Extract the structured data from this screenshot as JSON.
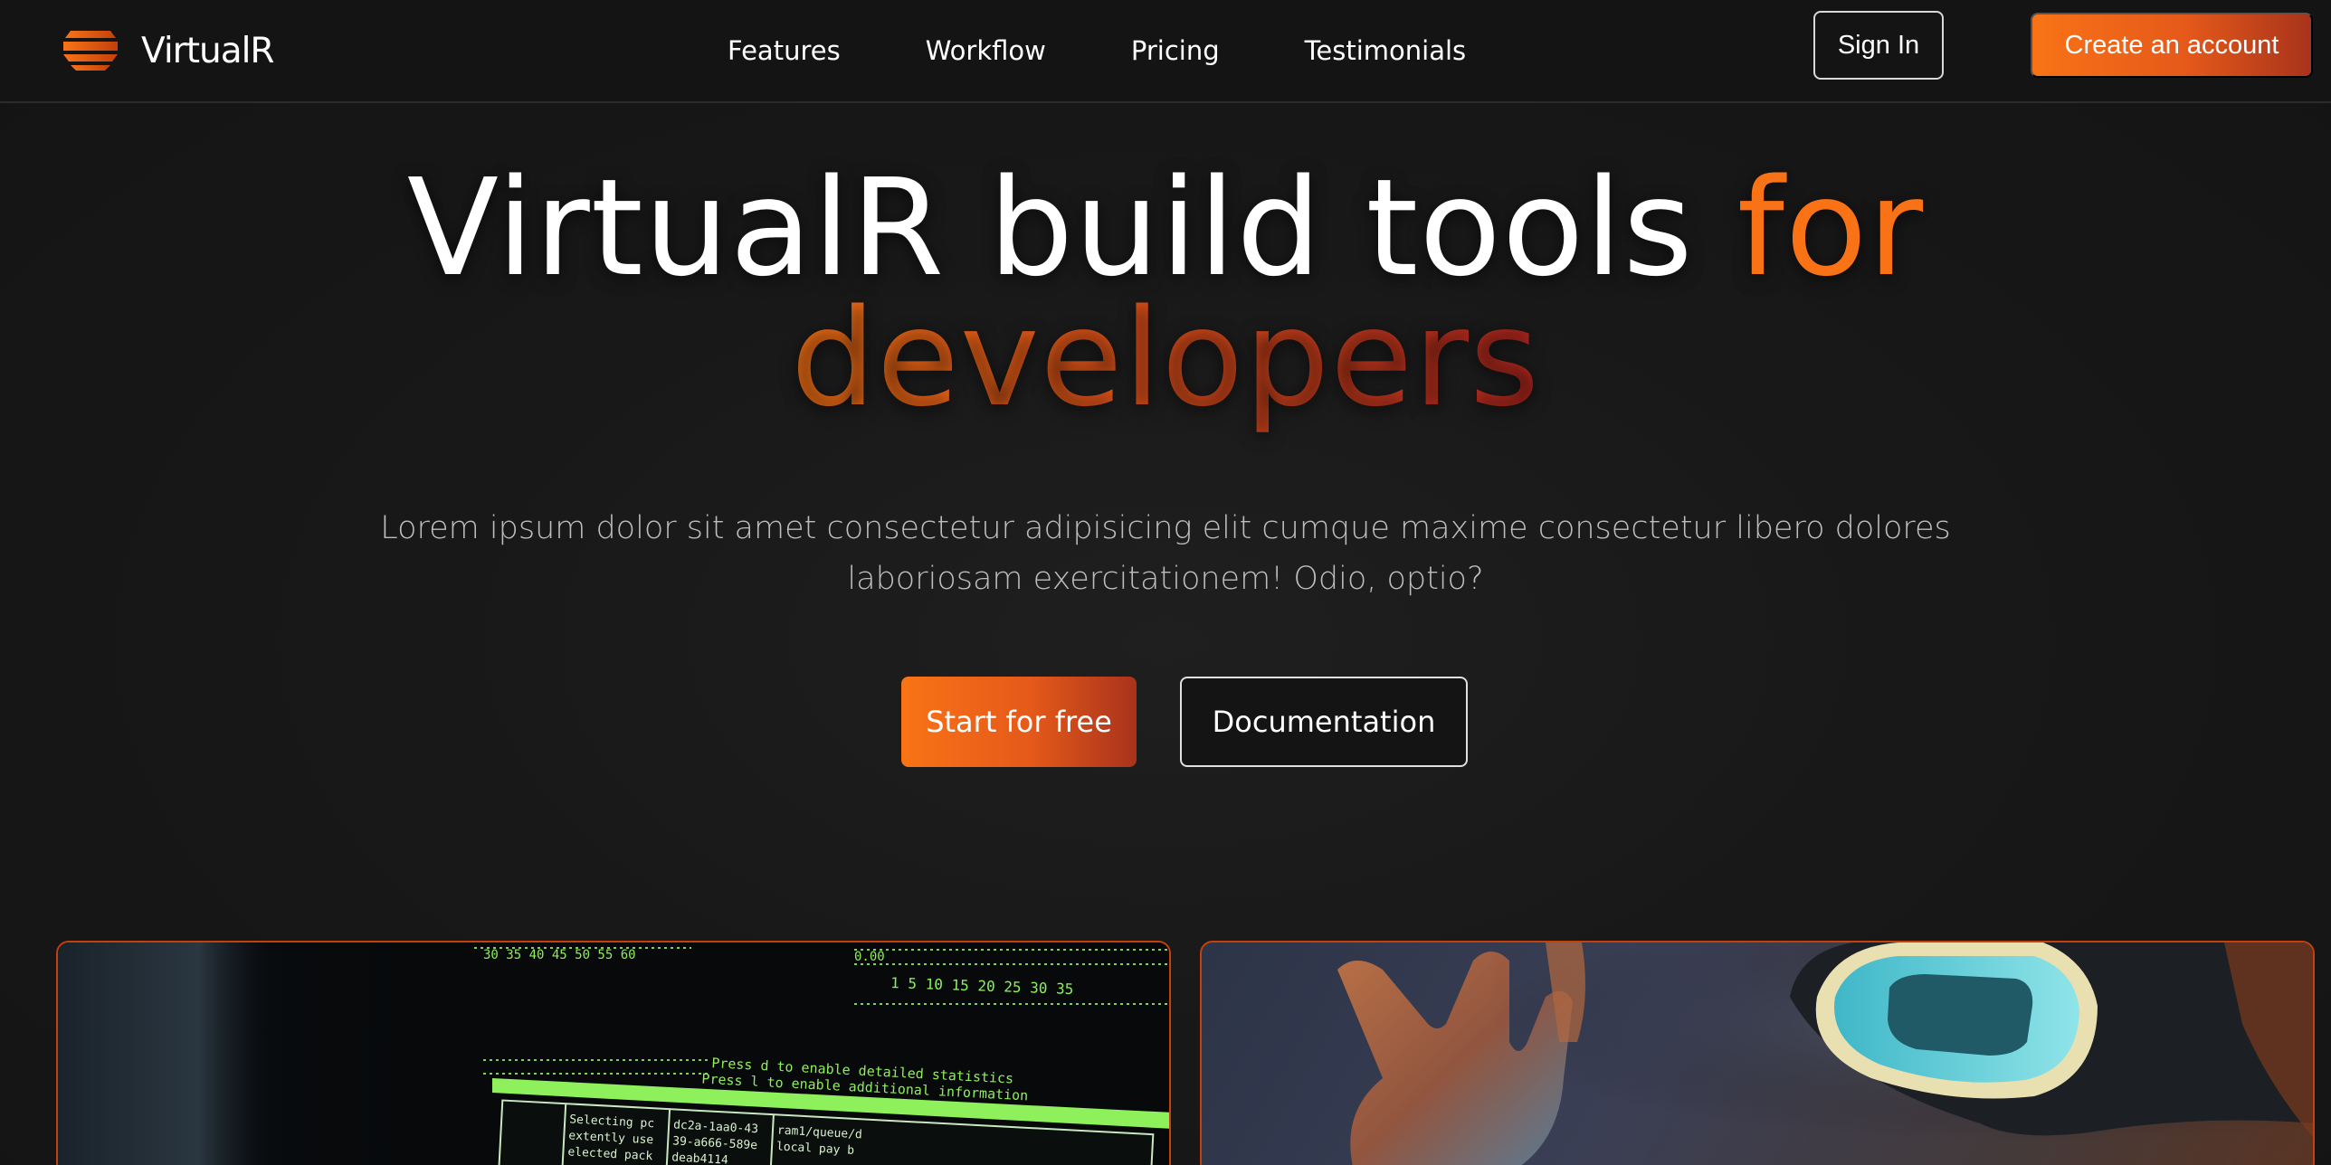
{
  "brand": {
    "name": "VirtualR",
    "logo_icon": "layered-bars-logo-icon"
  },
  "nav": {
    "links": [
      {
        "label": "Features"
      },
      {
        "label": "Workflow"
      },
      {
        "label": "Pricing"
      },
      {
        "label": "Testimonials"
      }
    ],
    "sign_in_label": "Sign In",
    "create_account_label": "Create an account"
  },
  "hero": {
    "title_main": "VirtualR build tools ",
    "title_accent": "for",
    "title_line2": "developers",
    "subtitle": "Lorem ipsum dolor sit amet consectetur adipisicing elit cumque maxime consectetur libero dolores laboriosam exercitationem! Odio, optio?",
    "primary_cta": "Start for free",
    "secondary_cta": "Documentation"
  },
  "terminal_card": {
    "ticks_top": "30 35 40 45 50 55 60",
    "ticks_right": "1 5 10 15 20 25 30 35",
    "stat_value": "0.00",
    "hint_line1": "Press d to enable detailed statistics",
    "hint_line2": "Press l to enable additional information",
    "col1_rows": [
      "Selecting pc",
      "extently use",
      "elected pack"
    ],
    "col2_rows": [
      "dc2a-1aa0-43",
      "39-a666-589e",
      "deab4114"
    ],
    "col3_rows": [
      "ram1/queue/d",
      "local pay b"
    ]
  },
  "colors": {
    "accent": "#f97316",
    "accent_dark": "#a8331b",
    "background": "#161616",
    "terminal_green": "#8ef05a"
  }
}
